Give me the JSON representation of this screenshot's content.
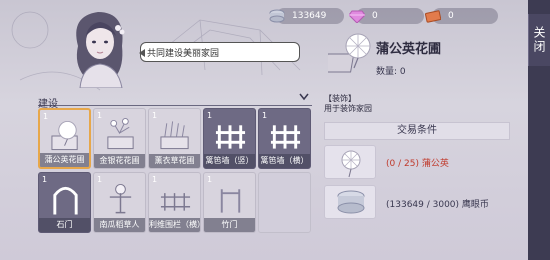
{
  "resources": [
    {
      "icon": "coin-stack-icon",
      "value": "133649"
    },
    {
      "icon": "pink-gem-icon",
      "value": "0"
    },
    {
      "icon": "ticket-icon",
      "value": "0"
    }
  ],
  "close_label": "关闭",
  "npc_speech": "共同建设美丽家园",
  "build": {
    "section_label": "建设",
    "items": [
      {
        "name": "蒲公英花圃",
        "count": "1",
        "selected": true,
        "style": "light",
        "icon": "dandelion-planter-icon"
      },
      {
        "name": "金银花花圃",
        "count": "1",
        "selected": false,
        "style": "light",
        "icon": "honeysuckle-planter-icon"
      },
      {
        "name": "薰衣草花圃",
        "count": "1",
        "selected": false,
        "style": "light",
        "icon": "lavender-planter-icon"
      },
      {
        "name": "篱笆墙（竖）",
        "count": "1",
        "selected": false,
        "style": "dark",
        "icon": "fence-vertical-icon"
      },
      {
        "name": "篱笆墙（横）",
        "count": "1",
        "selected": false,
        "style": "dark",
        "icon": "fence-horizontal-icon"
      },
      {
        "name": "石门",
        "count": "1",
        "selected": false,
        "style": "dark",
        "icon": "stone-arch-icon"
      },
      {
        "name": "南瓜稻草人",
        "count": "1",
        "selected": false,
        "style": "light",
        "icon": "pumpkin-scarecrow-icon"
      },
      {
        "name": "利维围栏（横）",
        "count": "1",
        "selected": false,
        "style": "light",
        "icon": "railing-icon"
      },
      {
        "name": "竹门",
        "count": "1",
        "selected": false,
        "style": "light",
        "icon": "bamboo-gate-icon"
      },
      {
        "name": "",
        "count": "",
        "selected": false,
        "style": "empty",
        "icon": ""
      }
    ]
  },
  "detail": {
    "name": "蒲公英花圃",
    "quantity": "数量: 0",
    "tag": "【装饰】",
    "description": "用于装饰家园",
    "trade_header": "交易条件",
    "requirements": [
      {
        "icon": "dandelion-icon",
        "progress": "(0 / 25)",
        "name": "蒲公英",
        "insufficient": true
      },
      {
        "icon": "coin-stack-icon",
        "progress": "(133649 / 3000)",
        "name": "鹰眼币",
        "insufficient": false
      }
    ]
  }
}
